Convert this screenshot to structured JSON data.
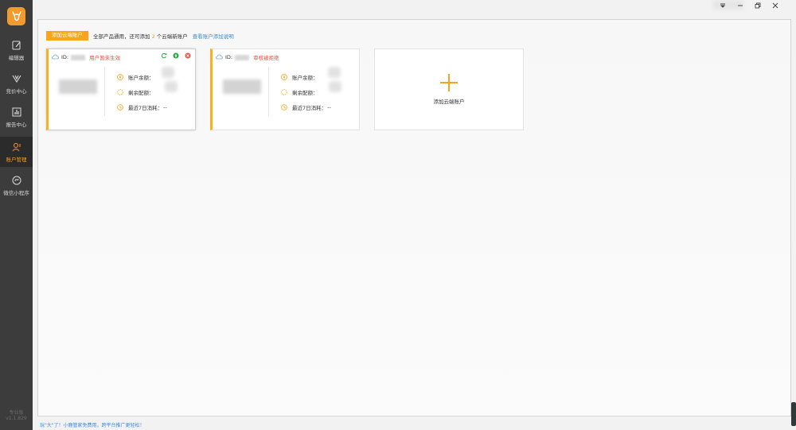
{
  "sidebar": {
    "logo_icon": "deer-icon",
    "items": [
      {
        "label": "编辑器",
        "icon": "pencil-icon"
      },
      {
        "label": "竞价中心",
        "icon": "bid-icon"
      },
      {
        "label": "报告中心",
        "icon": "chart-icon"
      },
      {
        "label": "账户管理",
        "icon": "user-icon",
        "active": true
      },
      {
        "label": "微信小程序",
        "icon": "miniprogram-icon"
      }
    ],
    "version_label": "专业版",
    "version": "v1.1.829"
  },
  "toolbar": {
    "add_button": "添加云端账户",
    "desc_prefix": "全部产品通用，还可添加",
    "remaining": "2",
    "desc_suffix": "个云端新账户",
    "help_link": "查看账户添加说明"
  },
  "cards": [
    {
      "id_label": "ID:",
      "status": "用户暂未生效",
      "balance_label": "账户余额：",
      "quota_label": "剩余配额：",
      "consumption_label": "最近7日消耗：",
      "consumption_value": "--"
    },
    {
      "id_label": "ID:",
      "status": "审核被拒绝",
      "balance_label": "账户余额：",
      "quota_label": "剩余配额：",
      "consumption_label": "最近7日消耗：",
      "consumption_value": "--"
    }
  ],
  "add_card": {
    "label": "添加云端账户"
  },
  "footer": {
    "tip": "玩\"大\"了！小鹿管家免费用，跨平台推广更轻松！"
  },
  "colors": {
    "accent": "#f8a51b",
    "link": "#3b8ad9",
    "error": "#e8503c",
    "sidebar": "#3c3c3c"
  }
}
